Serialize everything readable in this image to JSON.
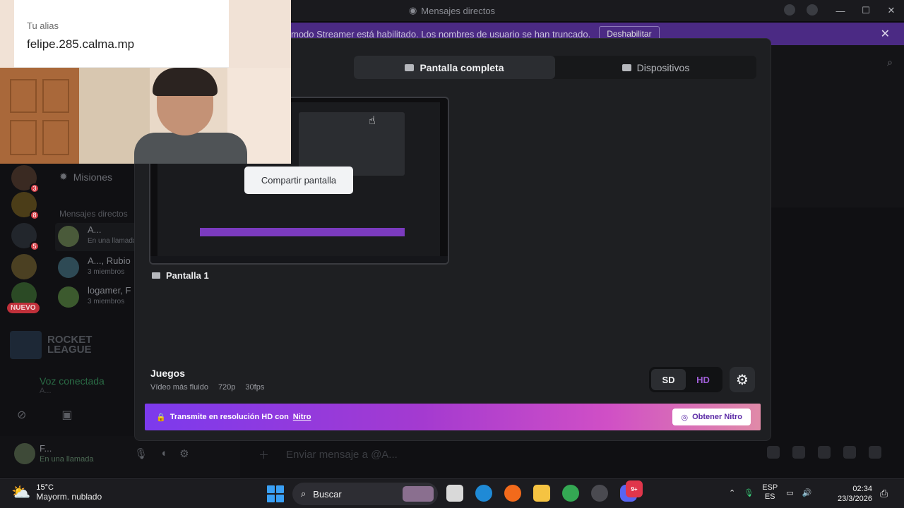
{
  "titlebar": {
    "title": "Mensajes directos",
    "minimize": "—",
    "maximize": "☐",
    "close": "✕"
  },
  "streamer_bar": {
    "text": "modo Streamer está habilitado. Los nombres de usuario se han truncado.",
    "button": "Deshabilitar",
    "close": "✕"
  },
  "background": {
    "search_icon": "⌕",
    "missions": "Misiones",
    "dm_header": "Mensajes directos",
    "dms": [
      {
        "name": "A...",
        "status": "En una llamada"
      },
      {
        "name": "A..., Rubio",
        "status": "3 miembros"
      },
      {
        "name": "logamer, F",
        "status": "3 miembros"
      }
    ],
    "server_badges": [
      "3",
      "8",
      "5"
    ],
    "new_badge": "NUEVO",
    "rocket_league": "ROCKET LEAGUE",
    "voice_connected": "Voz conectada",
    "voice_sub": "A...",
    "user_name": "F...",
    "user_status": "En una llamada",
    "message_placeholder": "Enviar mensaje a @A..."
  },
  "modal": {
    "tabs": [
      {
        "label": "Pantalla completa",
        "active": true
      },
      {
        "label": "Dispositivos",
        "active": false
      }
    ],
    "screen_label": "Pantalla 1",
    "tooltip": "Compartir pantalla",
    "quality": {
      "title": "Juegos",
      "desc": "Vídeo más fluido",
      "resolution": "720p",
      "fps": "30fps"
    },
    "sd": "SD",
    "hd": "HD",
    "settings_icon": "⚙",
    "nitro": {
      "text": "Transmite en resolución HD con",
      "link": "Nitro",
      "button": "Obtener Nitro"
    }
  },
  "webcam": {
    "alias_label": "Tu alias",
    "alias_value": "felipe.285.calma.mp"
  },
  "taskbar": {
    "temp": "15°C",
    "weather": "Mayorm. nublado",
    "search": "Buscar",
    "lang1": "ESP",
    "lang2": "ES",
    "time": "02:34",
    "date": "23/3/2026",
    "discord_badge": "9+"
  }
}
